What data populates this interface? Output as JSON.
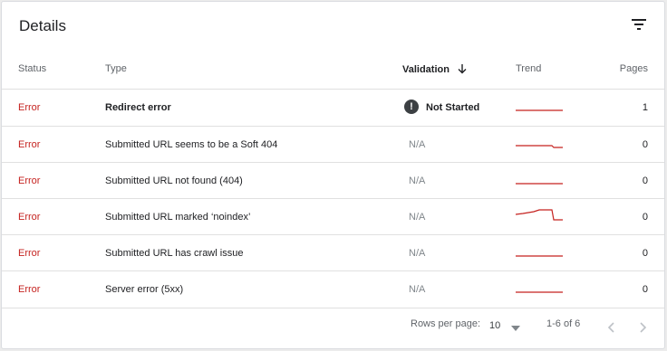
{
  "card": {
    "title": "Details"
  },
  "columns": {
    "status": "Status",
    "type": "Type",
    "validation": "Validation",
    "trend": "Trend",
    "pages": "Pages"
  },
  "rows": [
    {
      "status": "Error",
      "type": "Redirect error",
      "validation": "Not Started",
      "pages": "1"
    },
    {
      "status": "Error",
      "type": "Submitted URL seems to be a Soft 404",
      "validation": "N/A",
      "pages": "0"
    },
    {
      "status": "Error",
      "type": "Submitted URL not found (404)",
      "validation": "N/A",
      "pages": "0"
    },
    {
      "status": "Error",
      "type": "Submitted URL marked ‘noindex’",
      "validation": "N/A",
      "pages": "0"
    },
    {
      "status": "Error",
      "type": "Submitted URL has crawl issue",
      "validation": "N/A",
      "pages": "0"
    },
    {
      "status": "Error",
      "type": "Server error (5xx)",
      "validation": "N/A",
      "pages": "0"
    }
  ],
  "pagination": {
    "rows_per_page_label": "Rows per page:",
    "rows_per_page_value": "10",
    "range": "1-6 of 6"
  },
  "icons": {
    "filter": "filter-icon",
    "sort": "arrow-down-icon",
    "validation_status": "exclamation-icon",
    "dropdown": "dropdown-arrow-icon",
    "prev": "chevron-left-icon",
    "next": "chevron-right-icon"
  },
  "colors": {
    "error": "#c5221f",
    "trend": "#c5221f",
    "text": "#202124",
    "muted": "#80868b"
  }
}
